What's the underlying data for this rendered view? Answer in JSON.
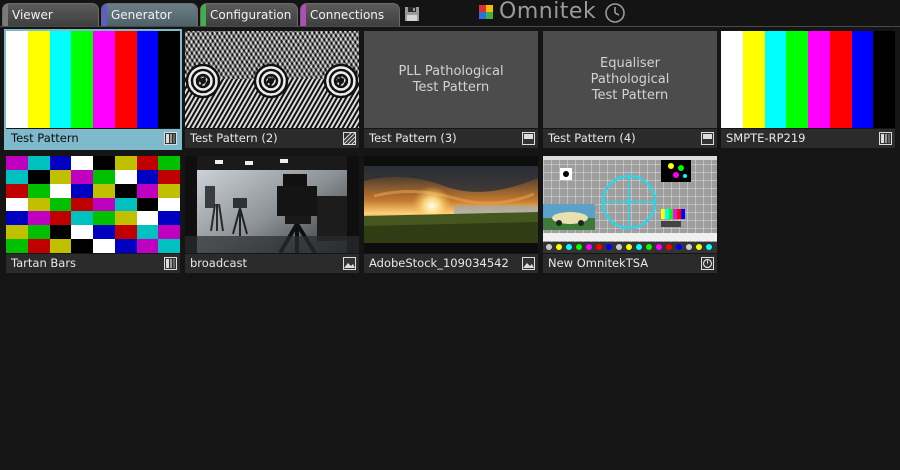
{
  "tabs": [
    {
      "label": "Viewer",
      "accent": "#7a7a7a"
    },
    {
      "label": "Generator",
      "accent": "#5b5fc7"
    },
    {
      "label": "Configuration",
      "accent": "#3fb04a"
    },
    {
      "label": "Connections",
      "accent": "#b84ab8"
    }
  ],
  "active_tab": "Generator",
  "brand": {
    "name": "Omnitek"
  },
  "patterns": [
    {
      "label": "Test Pattern",
      "selected": true,
      "icon": "bars-icon"
    },
    {
      "label": "Test Pattern (2)",
      "selected": false,
      "icon": "hatch-icon"
    },
    {
      "label": "Test Pattern (3)",
      "selected": false,
      "icon": "window-icon",
      "thumb_text": "PLL Pathological\nTest Pattern"
    },
    {
      "label": "Test Pattern (4)",
      "selected": false,
      "icon": "window-icon",
      "thumb_text": "Equaliser\nPathological\nTest Pattern"
    },
    {
      "label": "SMPTE-RP219",
      "selected": false,
      "icon": "bars-icon"
    },
    {
      "label": "Tartan Bars",
      "selected": false,
      "icon": "bars-icon"
    },
    {
      "label": "broadcast",
      "selected": false,
      "icon": "image-icon"
    },
    {
      "label": "AdobeStock_109034542",
      "selected": false,
      "icon": "image-icon"
    },
    {
      "label": "New OmnitekTSA",
      "selected": false,
      "icon": "clock-icon"
    }
  ],
  "colors": {
    "selection": "#7fb9cc",
    "background": "#151515",
    "caption": "#2b2b2b",
    "bars": [
      "#ffffff",
      "#ffff00",
      "#00ffff",
      "#00ff00",
      "#ff00ff",
      "#ff0000",
      "#0000ff",
      "#000000"
    ]
  }
}
